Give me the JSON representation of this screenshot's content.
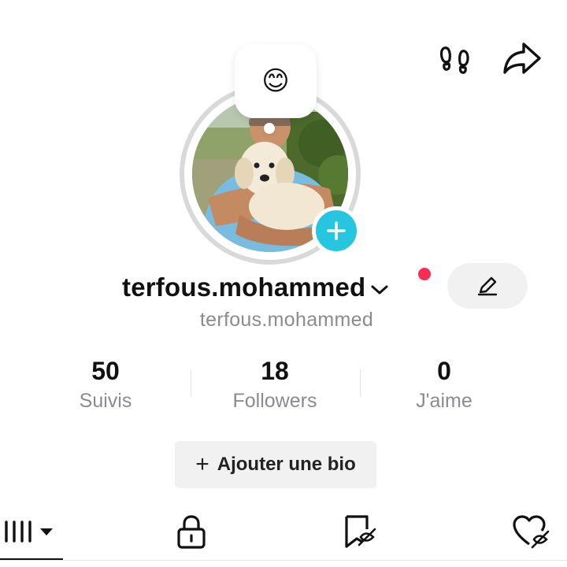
{
  "header": {
    "icons": [
      "footprints-icon",
      "share-icon"
    ]
  },
  "profile": {
    "mood_emoji": "😊",
    "username": "terfous.mohammed",
    "handle": "terfous.mohammed",
    "accent_color": "#26c6e0",
    "notification_color": "#fe2c55"
  },
  "stats": [
    {
      "value": "50",
      "label": "Suivis"
    },
    {
      "value": "18",
      "label": "Followers"
    },
    {
      "value": "0",
      "label": "J'aime"
    }
  ],
  "bio_button": {
    "label": "Ajouter une bio"
  },
  "tabs": [
    {
      "icon": "grid-icon",
      "active": true
    },
    {
      "icon": "lock-icon",
      "active": false
    },
    {
      "icon": "repost-icon",
      "active": false
    },
    {
      "icon": "liked-hidden-icon",
      "active": false
    }
  ]
}
